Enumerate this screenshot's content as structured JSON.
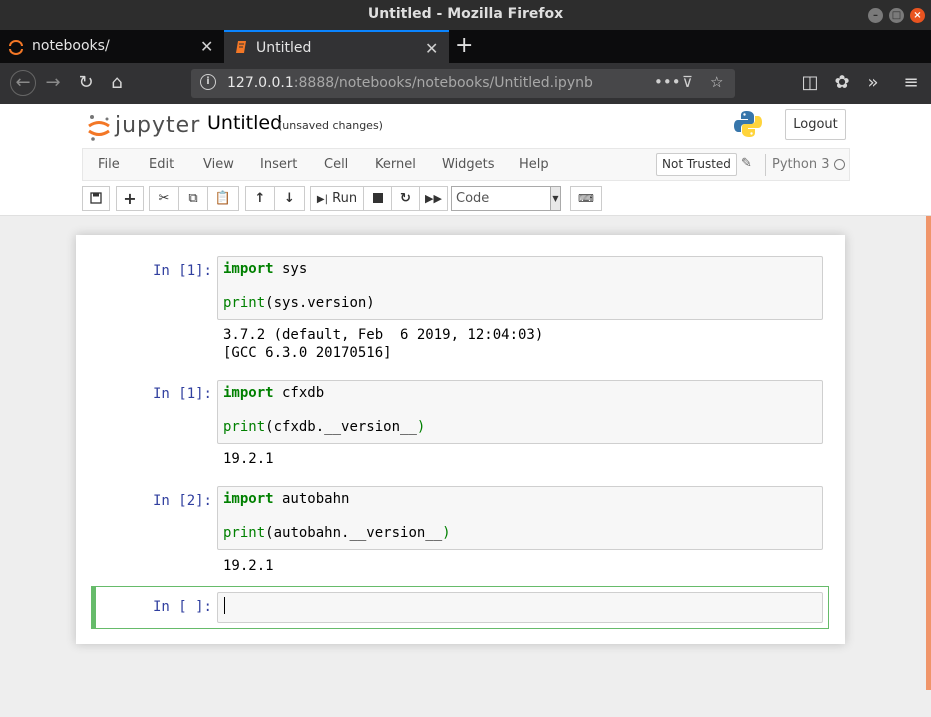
{
  "window": {
    "title": "Untitled - Mozilla Firefox"
  },
  "tabs": [
    {
      "label": "notebooks/",
      "active": false
    },
    {
      "label": "Untitled",
      "active": true
    }
  ],
  "url": {
    "host": "127.0.0.1",
    "rest": ":8888/notebooks/notebooks/Untitled.ipynb"
  },
  "header": {
    "logo_text": "jupyter",
    "notebook_name": "Untitled",
    "autosave_status": "(unsaved changes)",
    "logout_label": "Logout"
  },
  "menu": {
    "items": [
      "File",
      "Edit",
      "View",
      "Insert",
      "Cell",
      "Kernel",
      "Widgets",
      "Help"
    ],
    "trust_label": "Not Trusted",
    "kernel_name": "Python 3"
  },
  "toolbar": {
    "run_label": "Run",
    "cell_type": "Code"
  },
  "cells": [
    {
      "prompt": "In [1]:",
      "code_line1_kw": "import",
      "code_line1_rest": " sys",
      "code_line3_fn": "print",
      "code_line3_rest": "(sys.version)",
      "output": "3.7.2 (default, Feb  6 2019, 12:04:03)\n[GCC 6.3.0 20170516]"
    },
    {
      "prompt": "In [1]:",
      "code_line1_kw": "import",
      "code_line1_rest": " cfxdb",
      "code_line3_fn": "print",
      "code_line3_rest": "(cfxdb.__version__",
      "code_line3_close": ")",
      "output": "19.2.1"
    },
    {
      "prompt": "In [2]:",
      "code_line1_kw": "import",
      "code_line1_rest": " autobahn",
      "code_line3_fn": "print",
      "code_line3_rest": "(autobahn.__version__",
      "code_line3_close": ")",
      "output": "19.2.1"
    },
    {
      "prompt": "In [ ]:"
    }
  ],
  "colors": {
    "accent_tab": "#0a84ff",
    "prompt": "#303f9f",
    "keyword": "#008000",
    "selected_cell": "#66bb6a",
    "scrollbar": "#f0956a"
  }
}
